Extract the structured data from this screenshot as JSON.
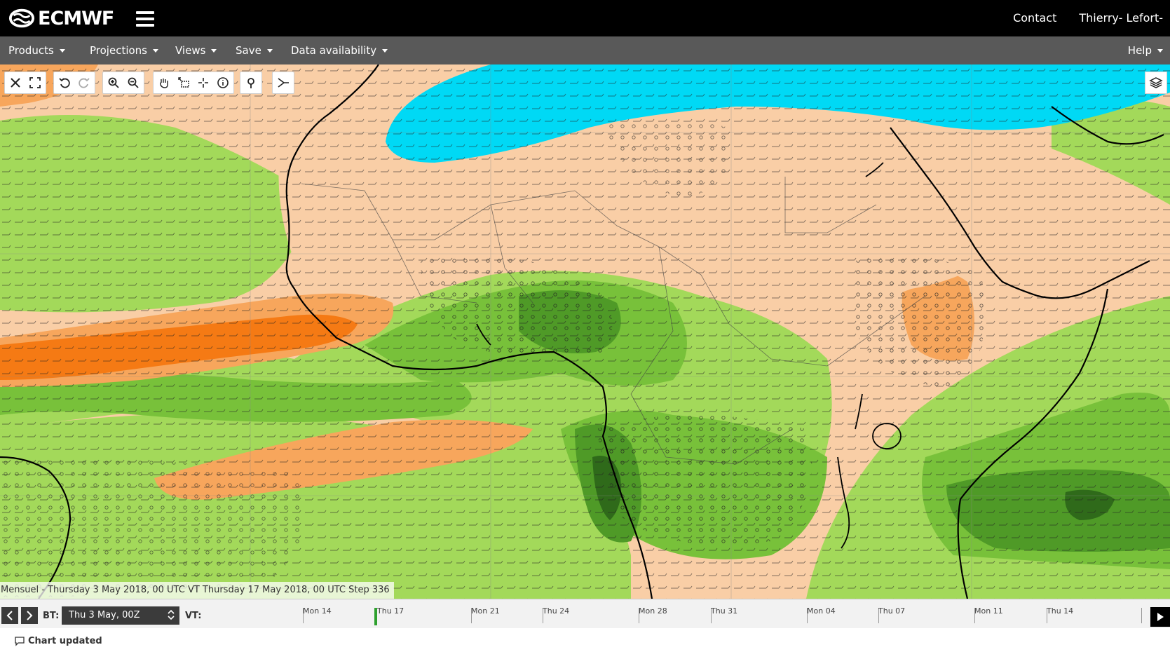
{
  "header": {
    "brand": "ECMWF",
    "contact_label": "Contact",
    "user_label": "Thierry- Lefort-"
  },
  "menu": {
    "items": [
      {
        "label": "Products"
      },
      {
        "label": "Projections"
      },
      {
        "label": "Views"
      },
      {
        "label": "Save"
      },
      {
        "label": "Data availability"
      }
    ],
    "help_label": "Help"
  },
  "map": {
    "caption": "Mensuel - Thursday 3 May 2018, 00 UTC VT Thursday 17 May 2018, 00 UTC Step 336",
    "colors": {
      "dry_light": "#f9cea6",
      "dry_mid": "#f7a65c",
      "dry_strong": "#f57a14",
      "wet_light": "#a3d95a",
      "wet_mid": "#78c13a",
      "wet_strong": "#4f9a27",
      "wet_darkest": "#2f6a1a",
      "cold": "#00d9f5"
    }
  },
  "toolbar": {
    "icons": [
      "close-icon",
      "fullscreen-icon",
      "undo-icon",
      "redo-icon",
      "zoom-in-icon",
      "zoom-out-icon",
      "pan-hand-icon",
      "box-zoom-icon",
      "crosshair-icon",
      "info-icon",
      "pin-icon",
      "cross-section-icon",
      "layers-icon"
    ]
  },
  "timeline": {
    "bt_label": "BT:",
    "bt_value": "Thu 3 May, 00Z",
    "vt_label": "VT:",
    "ticks": [
      "Mon 14",
      "Thu 17",
      "Mon 21",
      "Thu 24",
      "Mon 28",
      "Thu 31",
      "Mon 04",
      "Thu 07",
      "Mon 11",
      "Thu 14"
    ],
    "current_tick": "Thu 17"
  },
  "status": {
    "message": "Chart updated"
  }
}
